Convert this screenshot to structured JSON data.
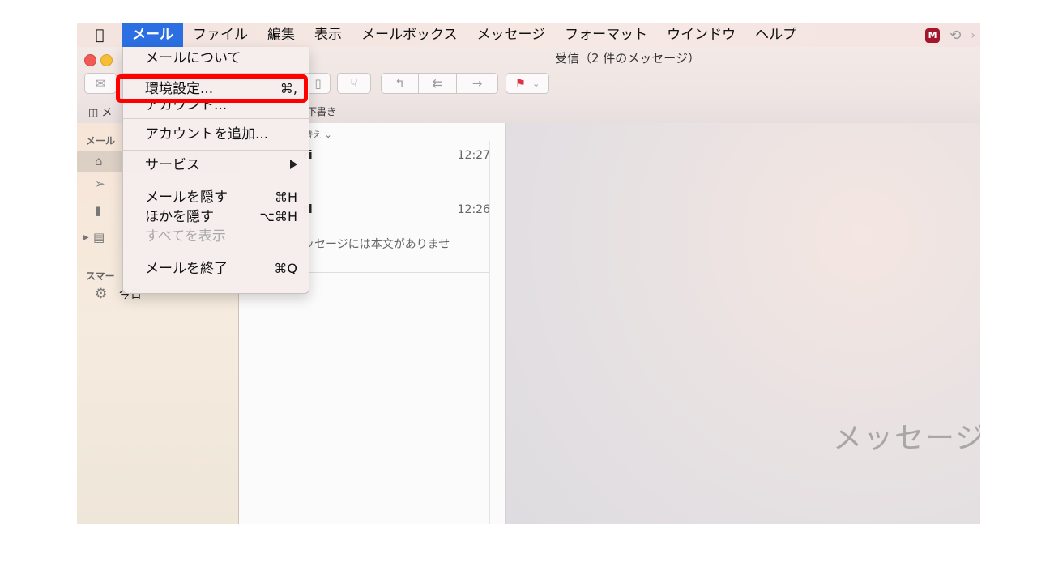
{
  "menubar": {
    "items": [
      "メール",
      "ファイル",
      "編集",
      "表示",
      "メールボックス",
      "メッセージ",
      "フォーマット",
      "ウインドウ",
      "ヘルプ"
    ],
    "active": "メール"
  },
  "window": {
    "title": "受信（2 件のメッセージ）"
  },
  "favorites": {
    "drafts": "下書き"
  },
  "sidebar": {
    "mailboxes_header": "メール",
    "smart_header": "スマー",
    "today_label": "今日"
  },
  "messages": {
    "sort_label": "替え ⌄",
    "items": [
      {
        "from": "ri",
        "time": "12:27",
        "preview": ""
      },
      {
        "from": "ri",
        "time": "12:26",
        "preview": "ッセージには本文がありませ"
      }
    ]
  },
  "pane": {
    "placeholder": "メッセージ"
  },
  "mail_menu": {
    "about": "メールについて",
    "preferences": "環境設定...",
    "preferences_shortcut": "⌘,",
    "accounts": "アカウント...",
    "add_account": "アカウントを追加...",
    "services": "サービス",
    "hide_mail": "メールを隠す",
    "hide_mail_shortcut": "⌘H",
    "hide_others": "ほかを隠す",
    "hide_others_shortcut": "⌥⌘H",
    "show_all": "すべてを表示",
    "quit": "メールを終了",
    "quit_shortcut": "⌘Q"
  },
  "colors": {
    "menu_highlight": "#2b6fe3",
    "annotation_box": "#ff0000"
  }
}
